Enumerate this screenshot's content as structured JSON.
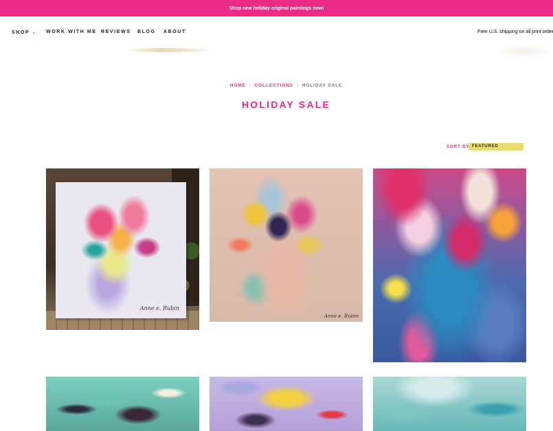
{
  "announcement": {
    "text": "Shop new holiday original paintings now!"
  },
  "nav": {
    "items": [
      {
        "label": "SHOP",
        "has_dropdown": true
      },
      {
        "label": "WORK WITH ME"
      },
      {
        "label": "REVIEWS"
      },
      {
        "label": "BLOG"
      },
      {
        "label": "ABOUT"
      }
    ],
    "dropdown_icon": "chevron-down-icon",
    "shipping_note": "Free U.S. shipping on all print orders ov"
  },
  "breadcrumb": {
    "items": [
      "HOME",
      "COLLECTIONS",
      "HOLIDAY SALE"
    ],
    "separator": "/"
  },
  "page": {
    "title": "HOLIDAY SALE"
  },
  "sort": {
    "label": "SORT BY:",
    "value": "FEATURED"
  },
  "products": [
    {
      "signature": "Anne e. Rubin"
    },
    {
      "signature": "Anne e. Rubin"
    },
    {
      "signature": ""
    },
    {
      "signature": ""
    },
    {
      "signature": ""
    },
    {
      "signature": ""
    }
  ],
  "colors": {
    "accent": "#ee2a87",
    "sort_bg": "#e8dd6d",
    "announcement_bg": "#ee2a87"
  }
}
